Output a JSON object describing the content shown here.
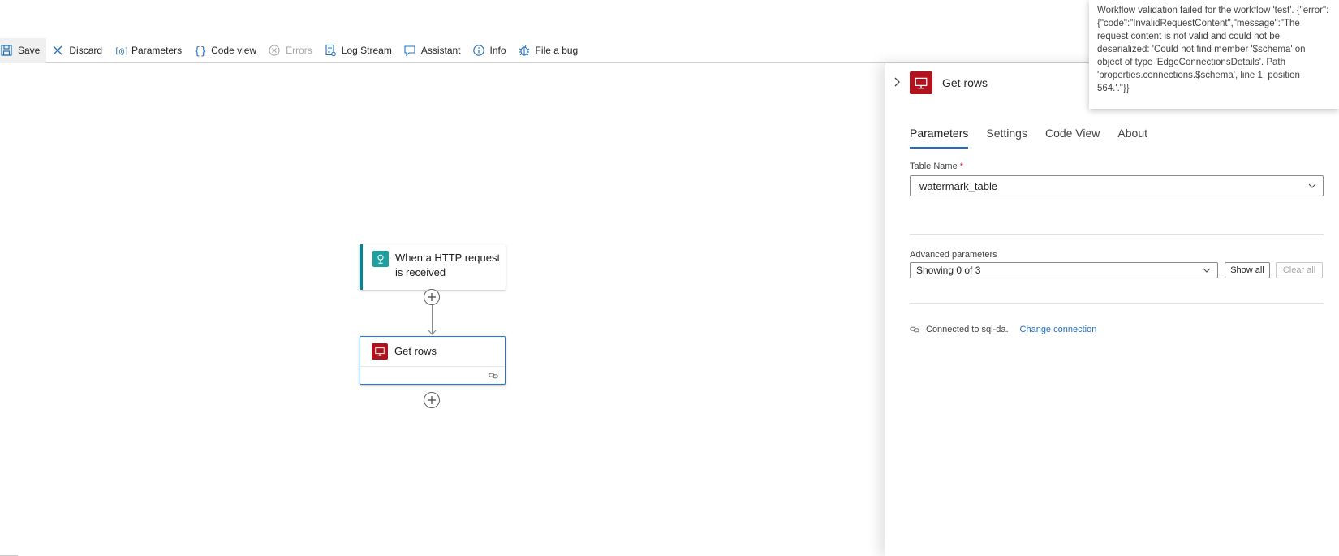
{
  "toolbar": {
    "save": "Save",
    "discard": "Discard",
    "parameters": "Parameters",
    "code_view": "Code view",
    "errors": "Errors",
    "log_stream": "Log Stream",
    "assistant": "Assistant",
    "info": "Info",
    "file_bug": "File a bug"
  },
  "canvas": {
    "trigger_title": "When a HTTP request is received",
    "action_title": "Get rows"
  },
  "panel": {
    "title": "Get rows",
    "tabs": [
      "Parameters",
      "Settings",
      "Code View",
      "About"
    ],
    "active_tab": "Parameters",
    "table_name_label": "Table Name",
    "required_marker": "*",
    "table_name_value": "watermark_table",
    "advanced_label": "Advanced parameters",
    "advanced_value": "Showing 0 of 3",
    "show_all": "Show all",
    "clear_all": "Clear all",
    "connected_text": "Connected to sql-da.",
    "change_connection": "Change connection"
  },
  "tooltip": {
    "message": "Workflow validation failed for the workflow 'test'. {\"error\":{\"code\":\"InvalidRequestContent\",\"message\":\"The request content is not valid and could not be deserialized: 'Could not find member '$schema' on object of type 'EdgeConnectionsDetails'. Path 'properties.connections.$schema', line 1, position 564.'.\"}}"
  },
  "colors": {
    "accent": "#1f6fbf",
    "sql_brand": "#b1121e",
    "http_brand": "#1f9fa0"
  },
  "icons": [
    "save-icon",
    "discard-icon",
    "parameters-icon",
    "code-view-icon",
    "errors-icon",
    "log-stream-icon",
    "assistant-icon",
    "info-icon",
    "bug-icon",
    "http-trigger-icon",
    "sql-icon",
    "link-icon",
    "plus-icon",
    "chevron-right-icon",
    "chevron-down-icon"
  ]
}
